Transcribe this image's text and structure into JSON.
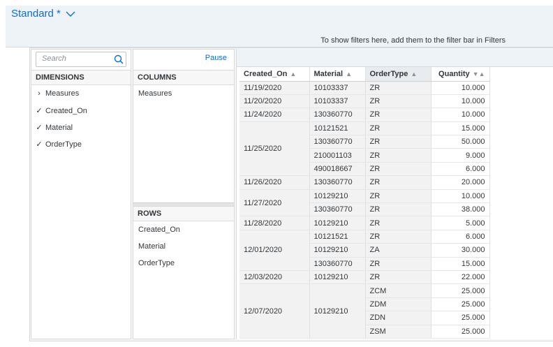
{
  "header": {
    "variant_label": "Standard *",
    "filter_hint": "To show filters here, add them to the filter bar in Filters"
  },
  "dimensions_panel": {
    "search_placeholder": "Search",
    "heading": "DIMENSIONS",
    "items": [
      {
        "label": "Measures",
        "mark": "›"
      },
      {
        "label": "Created_On",
        "mark": "✓"
      },
      {
        "label": "Material",
        "mark": "✓"
      },
      {
        "label": "OrderType",
        "mark": "✓"
      }
    ]
  },
  "layout_panel": {
    "pause_label": "Pause",
    "columns_heading": "COLUMNS",
    "columns_items": [
      "Measures"
    ],
    "rows_heading": "ROWS",
    "rows_items": [
      "Created_On",
      "Material",
      "OrderType"
    ]
  },
  "grid": {
    "headers": [
      "Created_On",
      "Material",
      "OrderType",
      "Quantity"
    ],
    "rows": [
      {
        "date": "11/19/2020",
        "material": "10103337",
        "type": "ZR",
        "qty": "10.000"
      },
      {
        "date": "11/20/2020",
        "material": "10103337",
        "type": "ZR",
        "qty": "10.000"
      },
      {
        "date": "11/24/2020",
        "material": "130360770",
        "type": "ZR",
        "qty": "10.000"
      },
      {
        "date": "11/25/2020",
        "material": "10121521",
        "type": "ZR",
        "qty": "15.000"
      },
      {
        "date": "",
        "material": "130360770",
        "type": "ZR",
        "qty": "50.000"
      },
      {
        "date": "",
        "material": "210001103",
        "type": "ZR",
        "qty": "9.000"
      },
      {
        "date": "",
        "material": "490018667",
        "type": "ZR",
        "qty": "6.000"
      },
      {
        "date": "11/26/2020",
        "material": "130360770",
        "type": "ZR",
        "qty": "20.000"
      },
      {
        "date": "11/27/2020",
        "material": "10129210",
        "type": "ZR",
        "qty": "10.000"
      },
      {
        "date": "",
        "material": "130360770",
        "type": "ZR",
        "qty": "38.000"
      },
      {
        "date": "11/28/2020",
        "material": "10129210",
        "type": "ZR",
        "qty": "5.000"
      },
      {
        "date": "12/01/2020",
        "material": "10121521",
        "type": "ZR",
        "qty": "6.000"
      },
      {
        "date": "",
        "material": "10129210",
        "type": "ZA",
        "qty": "30.000"
      },
      {
        "date": "",
        "material": "130360770",
        "type": "ZR",
        "qty": "15.000"
      },
      {
        "date": "12/03/2020",
        "material": "10129210",
        "type": "ZR",
        "qty": "22.000"
      },
      {
        "date": "12/07/2020",
        "material": "10129210",
        "type": "ZCM",
        "qty": "25.000"
      },
      {
        "date": "",
        "material": "",
        "type": "ZDM",
        "qty": "25.000"
      },
      {
        "date": "",
        "material": "",
        "type": "ZDN",
        "qty": "25.000"
      },
      {
        "date": "",
        "material": "",
        "type": "ZSM",
        "qty": "25.000"
      }
    ],
    "spans": {
      "date": [
        [
          0,
          1
        ],
        [
          1,
          1
        ],
        [
          2,
          1
        ],
        [
          3,
          4
        ],
        [
          7,
          1
        ],
        [
          8,
          2
        ],
        [
          10,
          1
        ],
        [
          11,
          3
        ],
        [
          14,
          1
        ],
        [
          15,
          4
        ]
      ],
      "material": [
        [
          0,
          1
        ],
        [
          1,
          1
        ],
        [
          2,
          1
        ],
        [
          3,
          1
        ],
        [
          4,
          1
        ],
        [
          5,
          1
        ],
        [
          6,
          1
        ],
        [
          7,
          1
        ],
        [
          8,
          1
        ],
        [
          9,
          1
        ],
        [
          10,
          1
        ],
        [
          11,
          1
        ],
        [
          12,
          1
        ],
        [
          13,
          1
        ],
        [
          14,
          1
        ],
        [
          15,
          4
        ]
      ]
    }
  },
  "colors": {
    "accent": "#0a6ed1",
    "header_bg": "#eef3f7",
    "row_header_bg": "#f2f2f2"
  }
}
